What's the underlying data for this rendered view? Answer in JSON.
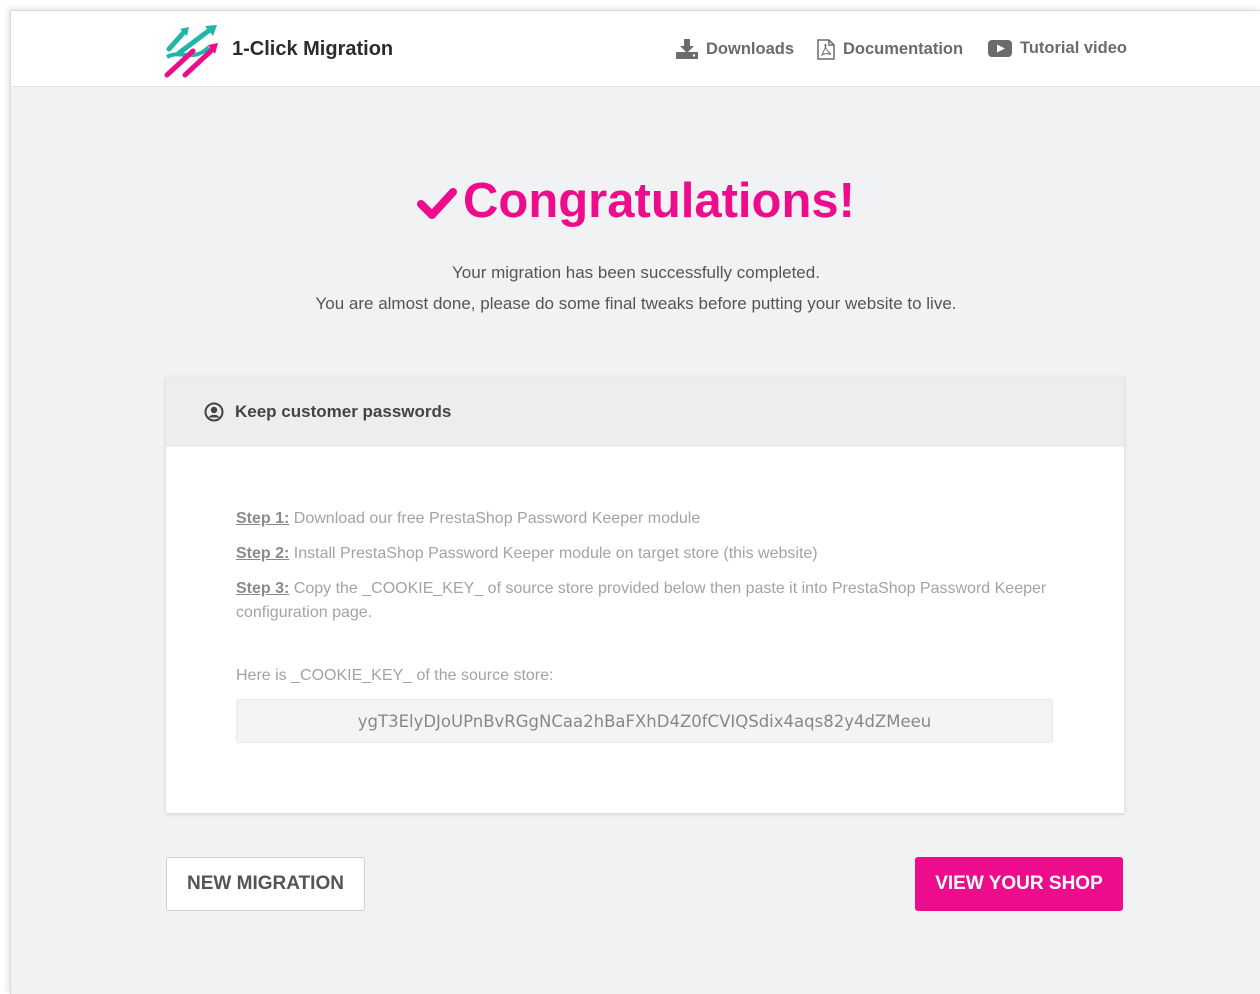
{
  "header": {
    "brand": "1-Click Migration",
    "nav": [
      {
        "label": "Downloads",
        "icon": "download-icon"
      },
      {
        "label": "Documentation",
        "icon": "pdf-file-icon"
      },
      {
        "label": "Tutorial video",
        "icon": "video-play-icon"
      }
    ]
  },
  "hero": {
    "title": "Congratulations!",
    "line1": "Your migration has been successfully completed.",
    "line2": "You are almost done, please do some final tweaks before putting your website to live."
  },
  "card": {
    "title": "Keep customer passwords",
    "steps": [
      {
        "label": "Step 1:",
        "text": " Download our free PrestaShop Password Keeper module"
      },
      {
        "label": "Step 2:",
        "text": " Install PrestaShop Password Keeper module on target store (this website)"
      },
      {
        "label": "Step 3:",
        "text": " Copy the _COOKIE_KEY_ of source store provided below then paste it into PrestaShop Password Keeper configuration page."
      }
    ],
    "cookie_label": "Here is _COOKIE_KEY_ of the source store:",
    "cookie_value": "ygT3ElyDJoUPnBvRGgNCaa2hBaFXhD4Z0fCVIQSdix4aqs82y4dZMeeu"
  },
  "buttons": {
    "new_migration": "NEW MIGRATION",
    "view_shop": "VIEW YOUR SHOP"
  },
  "colors": {
    "accent": "#ec0c8c",
    "teal": "#1fb5a8"
  }
}
